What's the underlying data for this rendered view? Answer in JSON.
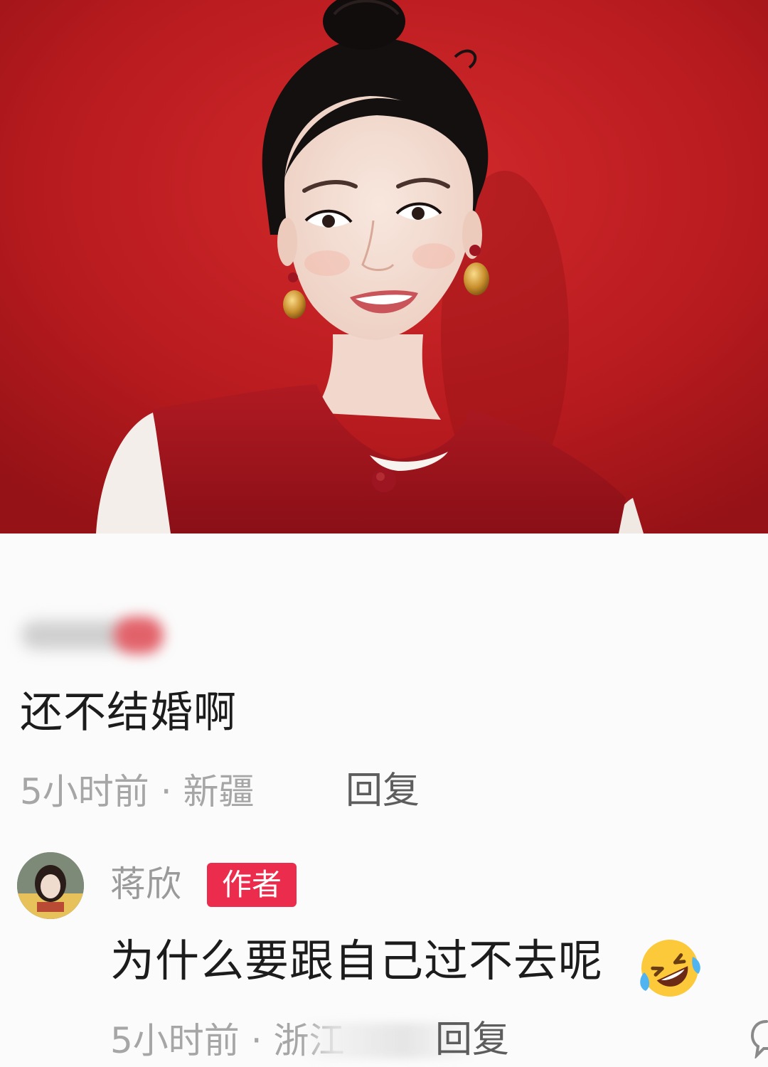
{
  "colors": {
    "backdrop_red": "#bd1d21",
    "author_badge": "#ec2c4d",
    "text_primary": "#1c1c1c",
    "text_meta": "#a6a6a6"
  },
  "photo": {
    "subject": "portrait"
  },
  "comments": [
    {
      "username_blurred": true,
      "text": "还不结婚啊",
      "meta": "5小时前 · 新疆",
      "reply_label": "回复"
    },
    {
      "username": "蒋欣",
      "badge": "作者",
      "text": "为什么要跟自己过不去呢",
      "emoji_icon": "rolling-on-floor-laughing-icon",
      "meta": "5小时前 · 浙江",
      "reply_label": "回复"
    }
  ]
}
